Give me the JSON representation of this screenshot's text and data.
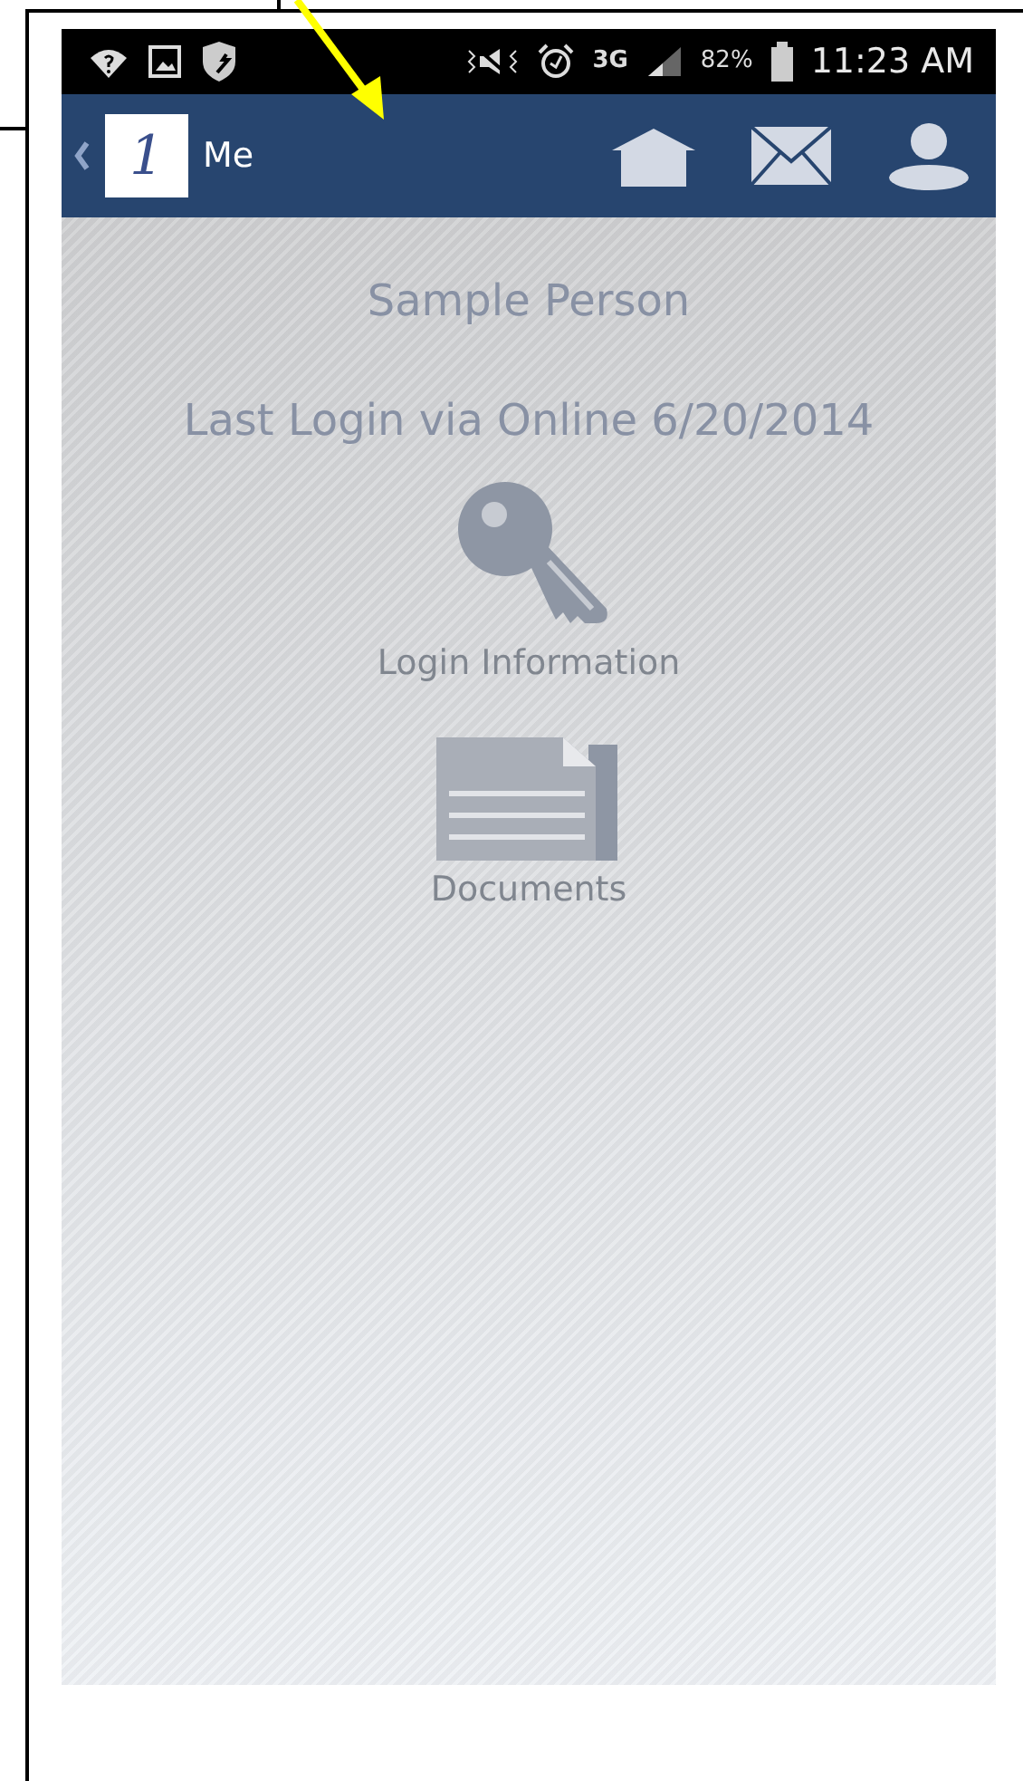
{
  "status_bar": {
    "network": "3G",
    "battery": "82%",
    "time": "11:23 AM"
  },
  "nav_bar": {
    "logo_text": "1",
    "title": "Me"
  },
  "profile": {
    "name": "Sample Person",
    "last_login": "Last Login via Online 6/20/2014"
  },
  "tiles": [
    {
      "kind": "key",
      "label": "Login Information"
    },
    {
      "kind": "documents",
      "label": "Documents"
    }
  ]
}
